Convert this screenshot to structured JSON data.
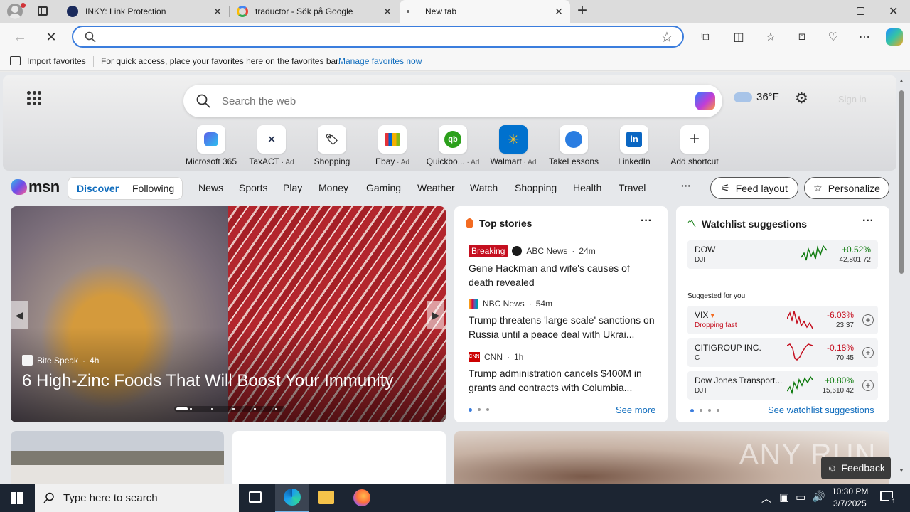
{
  "browser": {
    "tabs": [
      {
        "title": "INKY: Link Protection",
        "icon": "inky-icon"
      },
      {
        "title": "traductor - Sök på Google",
        "icon": "google-icon"
      },
      {
        "title": "New tab",
        "icon": "loading-icon",
        "active": true
      }
    ],
    "new_tab_label": "+",
    "address": {
      "value": "",
      "placeholder": ""
    },
    "favorites_bar": {
      "import_label": "Import favorites",
      "message": "For quick access, place your favorites here on the favorites bar.",
      "manage_link": "Manage favorites now"
    }
  },
  "newtab": {
    "search_placeholder": "Search the web",
    "weather": {
      "temp": "36°F",
      "icon": "cloud-icon"
    },
    "signin_label": "Sign in",
    "shortcuts": [
      {
        "label": "Microsoft 365",
        "ad": ""
      },
      {
        "label": "TaxACT",
        "ad": "Ad"
      },
      {
        "label": "Shopping",
        "ad": ""
      },
      {
        "label": "Ebay",
        "ad": "Ad"
      },
      {
        "label": "Quickbo...",
        "ad": "Ad"
      },
      {
        "label": "Walmart",
        "ad": "Ad"
      },
      {
        "label": "TakeLessons",
        "ad": ""
      },
      {
        "label": "LinkedIn",
        "ad": ""
      },
      {
        "label": "Add shortcut",
        "ad": ""
      }
    ]
  },
  "msn": {
    "logo": "msn",
    "tabs": [
      "Discover",
      "Following"
    ],
    "nav": [
      "News",
      "Sports",
      "Play",
      "Money",
      "Gaming",
      "Weather",
      "Watch",
      "Shopping",
      "Health",
      "Travel"
    ],
    "more": "···",
    "feed_layout_label": "Feed layout",
    "personalize_label": "Personalize"
  },
  "hero": {
    "source": "Bite Speak",
    "age": "4h",
    "headline": "6 High-Zinc Foods That Will Boost Your Immunity"
  },
  "top_stories": {
    "title": "Top stories",
    "see_more": "See more",
    "items": [
      {
        "badge": "Breaking",
        "source": "ABC News",
        "age": "24m",
        "headline": "Gene Hackman and wife's causes of death revealed"
      },
      {
        "badge": "",
        "source": "NBC News",
        "age": "54m",
        "headline": "Trump threatens 'large scale' sanctions on Russia until a peace deal with Ukrai..."
      },
      {
        "badge": "",
        "source": "CNN",
        "age": "1h",
        "headline": "Trump administration cancels $400M in grants and contracts with Columbia..."
      }
    ]
  },
  "watchlist": {
    "title": "Watchlist suggestions",
    "suggested_label": "Suggested for you",
    "see_all": "See watchlist suggestions",
    "dow": {
      "name": "DOW",
      "sub": "DJI",
      "pct": "+0.52%",
      "price": "42,801.72"
    },
    "items": [
      {
        "name": "VIX",
        "sub": "Dropping fast",
        "pct": "-6.03%",
        "price": "23.37",
        "trend": "down"
      },
      {
        "name": "CITIGROUP INC.",
        "sub": "C",
        "pct": "-0.18%",
        "price": "70.45",
        "trend": "down"
      },
      {
        "name": "Dow Jones Transport...",
        "sub": "DJT",
        "pct": "+0.80%",
        "price": "15,610.42",
        "trend": "up"
      }
    ]
  },
  "feedback_label": "Feedback",
  "watermark": "ANY RUN",
  "taskbar": {
    "search_placeholder": "Type here to search",
    "time": "10:30 PM",
    "date": "3/7/2025",
    "notification_count": "1"
  },
  "colors": {
    "accent": "#0f6cbd",
    "up": "#107c10",
    "down": "#c50f1f",
    "taskbar": "#1c2532",
    "breaking": "#c50f1f"
  }
}
